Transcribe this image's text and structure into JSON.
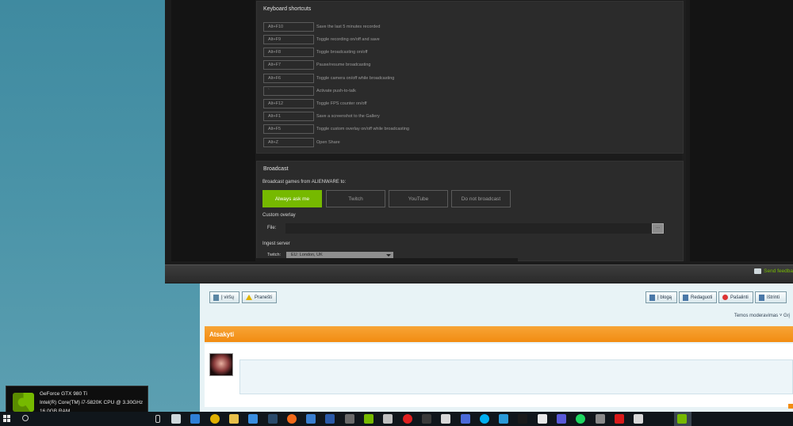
{
  "keyboard_shortcuts": {
    "title": "Keyboard shortcuts",
    "rows": [
      {
        "key": "Alt+F10",
        "desc": "Save the last 5 minutes recorded"
      },
      {
        "key": "Alt+F9",
        "desc": "Toggle recording on/off and save"
      },
      {
        "key": "Alt+F8",
        "desc": "Toggle broadcasting on/off"
      },
      {
        "key": "Alt+F7",
        "desc": "Pause/resume broadcasting"
      },
      {
        "key": "Alt+F6",
        "desc": "Toggle camera on/off while broadcasting"
      },
      {
        "key": "`",
        "desc": "Activate push-to-talk"
      },
      {
        "key": "Alt+F12",
        "desc": "Toggle FPS counter on/off"
      },
      {
        "key": "Alt+F1",
        "desc": "Save a screenshot to the Gallery"
      },
      {
        "key": "Alt+F5",
        "desc": "Toggle custom overlay on/off while broadcasting"
      },
      {
        "key": "Alt+Z",
        "desc": "Open Share"
      }
    ]
  },
  "broadcast": {
    "title": "Broadcast",
    "games_label": "Broadcast games from ALIENWARE to:",
    "options": [
      "Always ask me",
      "Twitch",
      "YouTube",
      "Do not broadcast"
    ],
    "selected": "Always ask me",
    "custom_overlay_label": "Custom overlay",
    "file_label": "File:",
    "file_button": "...",
    "ingest_label": "Ingest server",
    "twitch_label": "Twitch:",
    "twitch_value": "EU: London, UK"
  },
  "feedback": {
    "label": "Send feedba"
  },
  "forum": {
    "buttons_left": [
      {
        "label": "Į viršų",
        "icon": "page-icon"
      },
      {
        "label": "Pranešti",
        "icon": "warning-icon"
      }
    ],
    "buttons_right": [
      {
        "label": "Į blogą",
        "icon": "blog-icon"
      },
      {
        "label": "Redaguoti",
        "icon": "edit-icon"
      },
      {
        "label": "Pašalinti",
        "icon": "delete-icon"
      },
      {
        "label": "Ištrinti",
        "icon": "comment-icon"
      }
    ],
    "moderation_text": "Temos moderavimas ˅ Grį",
    "section_title": "Atsakyti"
  },
  "gpu_info": {
    "gpu": "GeForce GTX 980 Ti",
    "cpu": "Intel(R) Core(TM) i7-5820K CPU @ 3.30GHz",
    "ram": "16.0GB RAM"
  },
  "colors": {
    "accent": "#76b900",
    "panel": "#2b2b2b",
    "forum_orange": "#f28c12"
  },
  "taskbar": {
    "icons": [
      {
        "name": "task-view-icon",
        "color": "#cfd8dc"
      },
      {
        "name": "edge-icon",
        "color": "#2f7fd6"
      },
      {
        "name": "chrome-icon",
        "color": "#e0b000"
      },
      {
        "name": "file-explorer-icon",
        "color": "#e8c04a"
      },
      {
        "name": "store-icon",
        "color": "#3a8ee0"
      },
      {
        "name": "steam-icon",
        "color": "#2a4a6a"
      },
      {
        "name": "origin-icon",
        "color": "#f26a1b"
      },
      {
        "name": "app-icon",
        "color": "#3a7fd0"
      },
      {
        "name": "tv-icon",
        "color": "#2b5aa8"
      },
      {
        "name": "wot-icon",
        "color": "#6a6a6a"
      },
      {
        "name": "nvidia-icon",
        "color": "#76b900"
      },
      {
        "name": "bug-icon",
        "color": "#c0c0c0"
      },
      {
        "name": "record-icon",
        "color": "#e02020"
      },
      {
        "name": "camera-icon",
        "color": "#3a3a3a"
      },
      {
        "name": "window-icon",
        "color": "#d8d8d8"
      },
      {
        "name": "blue-app-icon",
        "color": "#4a6ad8"
      },
      {
        "name": "skype-icon",
        "color": "#00aff0"
      },
      {
        "name": "mail-icon",
        "color": "#2a9ad8"
      },
      {
        "name": "media-icon",
        "color": "#1a1a1a"
      },
      {
        "name": "screenshot-icon",
        "color": "#e8e8e8"
      },
      {
        "name": "phone-icon",
        "color": "#5a5ad8"
      },
      {
        "name": "spotify-icon",
        "color": "#1ed760"
      },
      {
        "name": "speaker-icon",
        "color": "#8a8a8a"
      },
      {
        "name": "red-app-icon",
        "color": "#d81a1a"
      },
      {
        "name": "printer-icon",
        "color": "#d8d8d8"
      },
      {
        "name": "geforce-icon",
        "color": "#76b900"
      }
    ]
  }
}
